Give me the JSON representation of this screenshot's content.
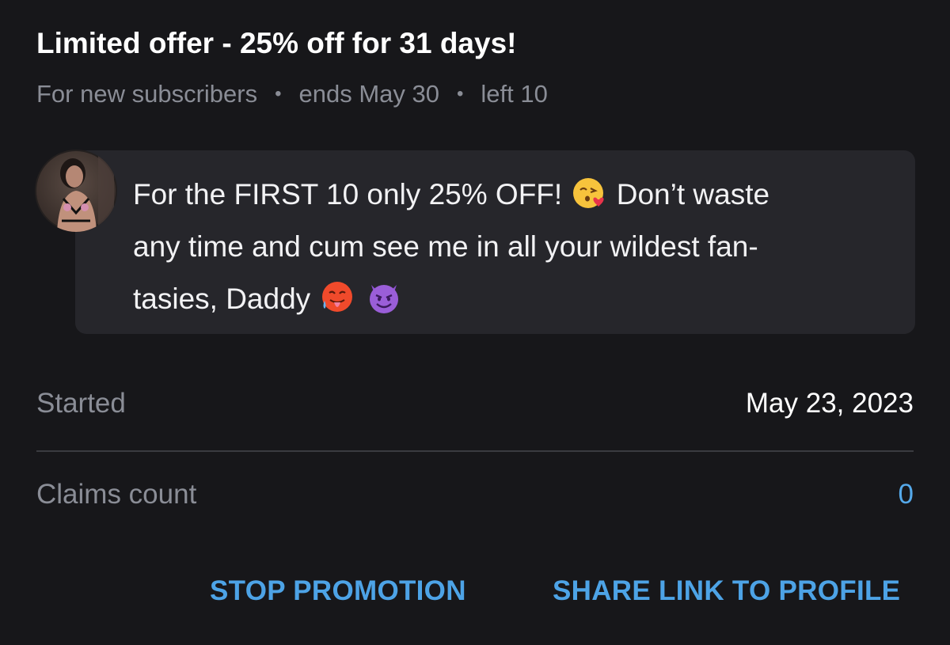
{
  "offer": {
    "title": "Limited offer - 25% off for 31 days!",
    "audience": "For new subscribers",
    "ends": "ends May 30",
    "left": "left 10"
  },
  "message": {
    "line1": "For the FIRST 10 only 25% OFF!",
    "line1_after": "Don’t waste",
    "line2": "any time and cum see me in all your wildest fan-",
    "line3": "tasies, Daddy",
    "emojis": [
      "kissing-heart-emoji",
      "hot-face-emoji",
      "smiling-devil-emoji"
    ]
  },
  "details": {
    "started_label": "Started",
    "started_value": "May 23, 2023",
    "claims_label": "Claims count",
    "claims_value": "0"
  },
  "actions": {
    "stop": "STOP PROMOTION",
    "share": "SHARE LINK TO PROFILE"
  },
  "colors": {
    "background": "#17171a",
    "card": "#26262b",
    "accent": "#4da3e6",
    "muted": "#8a8d96"
  }
}
